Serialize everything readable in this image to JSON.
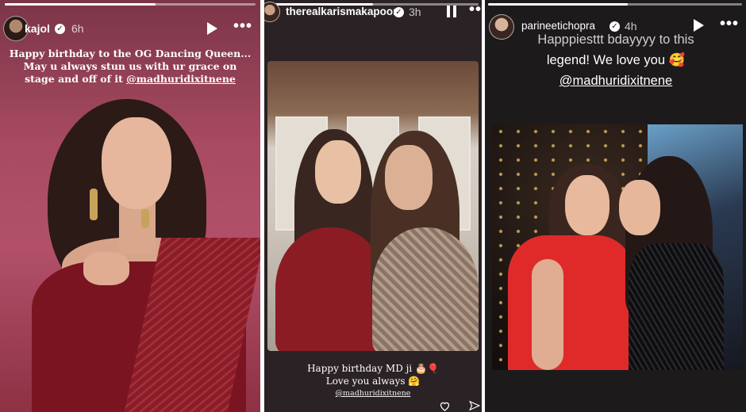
{
  "stories": [
    {
      "username": "kajol",
      "time": "6h",
      "caption_lines": [
        "Happy birthday to the OG Dancing Queen...",
        "May u always stun us with ur grace on",
        "stage and off of it "
      ],
      "mention": "@madhuridixitnene",
      "progress": 0.6
    },
    {
      "username": "therealkarismakapoor",
      "time": "3h",
      "caption_line1": "Happy birthday MD ji 🎂🎈",
      "caption_line2": "Love you always 🤗",
      "mention": "@madhuridixitnene",
      "progress": 0.5
    },
    {
      "username": "parineetichopra",
      "time": "4h",
      "caption_line1": "Happpiesttt bdayyyy to this",
      "caption_line2": "legend! We love you 🥰",
      "mention": "@madhuridixitnene",
      "progress": 0.55
    }
  ],
  "colors": {
    "panel1_bg": "#a84a62",
    "panel2_bg": "#2a2224",
    "panel3_bg": "#1d1a1b",
    "saree_red": "#7a1420",
    "dress_red": "#e02a2a"
  },
  "icons": [
    "verified-badge-icon",
    "play-icon",
    "pause-icon",
    "more-options-icon",
    "heart-icon",
    "send-icon"
  ]
}
